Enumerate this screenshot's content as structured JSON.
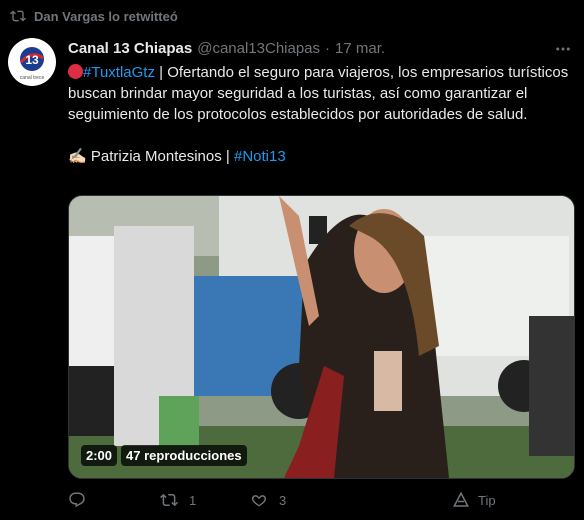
{
  "retweet": {
    "text": "Dan Vargas lo retwitteó",
    "icon": "retweet-icon"
  },
  "account": {
    "name": "Canal 13 Chiapas",
    "handle": "@canal13Chiapas",
    "separator": "·",
    "date": "17 mar.",
    "avatar_label": "13",
    "avatar_caption": "canal trece"
  },
  "tweet": {
    "hashtag1": "#TuxtlaGtz",
    "text1": " | Ofertando el seguro para viajeros, los empresarios turísticos buscan brindar mayor seguridad a los turistas, así como garantizar el seguimiento de los protocolos establecidos por autoridades de salud.",
    "sig_emoji": "✍🏻",
    "sig_text": " Patrizia Montesinos | ",
    "hashtag2": "#Noti13"
  },
  "video": {
    "duration": "2:00",
    "views": "47 reproducciones"
  },
  "actions": {
    "replies": "",
    "retweets": "1",
    "likes": "3",
    "tip": "Tip"
  },
  "colors": {
    "accent": "#1d9bf0",
    "muted": "#71767b",
    "background": "#000000"
  }
}
